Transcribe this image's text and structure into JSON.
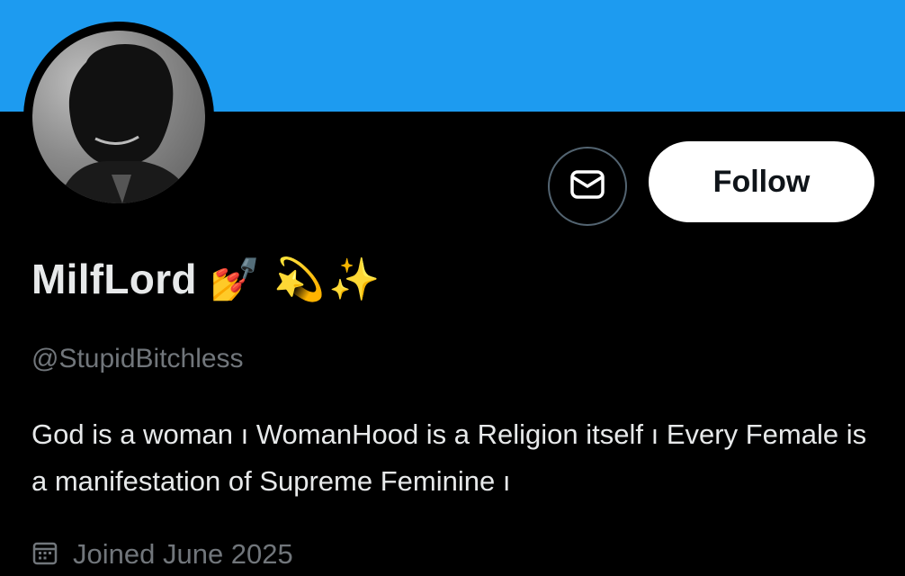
{
  "colors": {
    "banner": "#1d9bf0",
    "background": "#000000",
    "text_primary": "#e7e9ea",
    "text_secondary": "#71767b",
    "follow_button_bg": "#ffffff",
    "follow_button_text": "#0f1419",
    "message_button_border": "#536471"
  },
  "profile": {
    "display_name": "MilfLord",
    "name_emojis": [
      "💅",
      "💫",
      "✨"
    ],
    "handle": "@StupidBitchless",
    "bio": "God is a woman ı  WomanHood is a Religion itself ı  Every Female is a manifestation of Supreme Feminine ı",
    "joined": "Joined June 2025"
  },
  "actions": {
    "message_icon": "mail-icon",
    "follow_label": "Follow"
  },
  "icons": {
    "avatar": "avatar-photo",
    "joined": "calendar-icon"
  }
}
